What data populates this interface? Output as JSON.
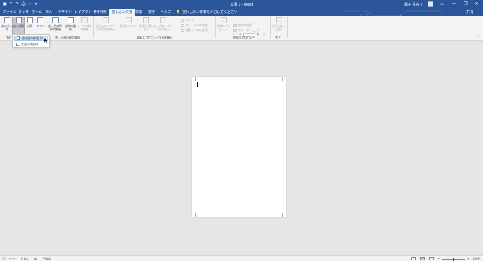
{
  "titlebar": {
    "title": "文書 1 - Word",
    "user": "露子 長谷川",
    "qat_icons": [
      "save-icon",
      "undo-icon",
      "redo-icon",
      "print-preview-icon",
      "touch-mode-icon",
      "customize-icon"
    ],
    "qat_glyphs": [
      "▣",
      "↶",
      "↷",
      "⎙",
      "☝",
      "▾"
    ],
    "window_controls": {
      "ribbon_options": "▭",
      "minimize": "—",
      "restore": "❐",
      "close": "✕"
    }
  },
  "tabs": [
    {
      "label": "ファイル"
    },
    {
      "label": "タッチ"
    },
    {
      "label": "ホーム"
    },
    {
      "label": "挿入"
    },
    {
      "label": "デザイン"
    },
    {
      "label": "レイアウト"
    },
    {
      "label": "参考資料"
    },
    {
      "label": "差し込み文書"
    },
    {
      "label": "校閲"
    },
    {
      "label": "表示"
    },
    {
      "label": "ヘルプ"
    }
  ],
  "active_tab": "差し込み文書",
  "tellme": {
    "icon_glyph": "💡",
    "text": "実行したい作業を入力してください"
  },
  "share": "共有",
  "ribbon": {
    "groups": [
      {
        "label": "作成"
      },
      {
        "label": "差し込み印刷の開始"
      },
      {
        "label": "文章入力とフィールドの挿入"
      },
      {
        "label": "結果のプレビュー"
      },
      {
        "label": "完了"
      }
    ],
    "buttons": {
      "envelope": "あいさつ文",
      "envelope2": "",
      "label_print": "宛名印刷",
      "envelope_btn": "封筒",
      "label_btn": "ラベル",
      "start_merge": "差し込み印刷の開始",
      "select_recipients": "宛先の選択",
      "edit_list": "アドレス帳の編集",
      "highlight": "差し込みフィールドの強調表示",
      "address_block": "住所ブロック",
      "greeting": "挨拶文(英文)",
      "insert_field": "差し込みフィールドの挿入",
      "preview": "結果のプレビュー",
      "finish": "完了と差し込み"
    },
    "small_cmds": {
      "rules": "ルール",
      "match_fields": "フィールドの対応",
      "update_labels": "複数ラベルに反映",
      "find_recipient": "宛先の検索",
      "check_errors": "エラーのチェック"
    }
  },
  "dropdown": {
    "items": [
      {
        "label": "宛名面の作成(A)..."
      },
      {
        "label": "文面の作成(B)"
      }
    ]
  },
  "statusbar": {
    "page": "1/1 ページ",
    "words": "0 文字",
    "language": "日本語",
    "zoom": "100%",
    "zoom_minus": "−",
    "zoom_plus": "+"
  },
  "colors": {
    "brand": "#2b579a",
    "ribbon": "#f3f3f3",
    "canvas": "#e6e6e6"
  }
}
